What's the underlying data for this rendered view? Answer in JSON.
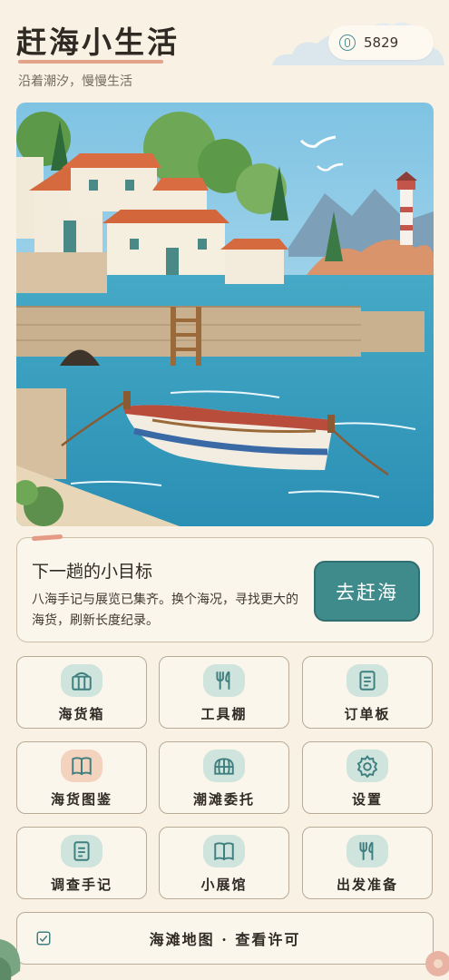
{
  "header": {
    "title": "赶海小生活",
    "subtitle": "沿着潮汐，慢慢生活",
    "coins": "5829",
    "coin_icon": "coin-icon"
  },
  "goal": {
    "title": "下一趟的小目标",
    "description": "八海手记与展览已集齐。换个海况，寻找更大的海货，刷新长度纪录。",
    "button_label": "去赶海"
  },
  "menu": {
    "items": [
      {
        "label": "海货箱",
        "icon": "crate-icon"
      },
      {
        "label": "工具棚",
        "icon": "tools-icon"
      },
      {
        "label": "订单板",
        "icon": "order-board-icon"
      },
      {
        "label": "海货图鉴",
        "icon": "book-icon"
      },
      {
        "label": "潮滩委托",
        "icon": "dome-icon"
      },
      {
        "label": "设置",
        "icon": "gear-icon"
      },
      {
        "label": "调查手记",
        "icon": "notes-icon"
      },
      {
        "label": "小展馆",
        "icon": "museum-book-icon"
      },
      {
        "label": "出发准备",
        "icon": "utensils-icon"
      }
    ]
  },
  "map_bar": {
    "label": "海滩地图 · 查看许可",
    "icon": "checkbox-icon"
  },
  "colors": {
    "background": "#f8f1e4",
    "accent_teal": "#3f8a8a",
    "accent_peach": "#e59a84"
  }
}
